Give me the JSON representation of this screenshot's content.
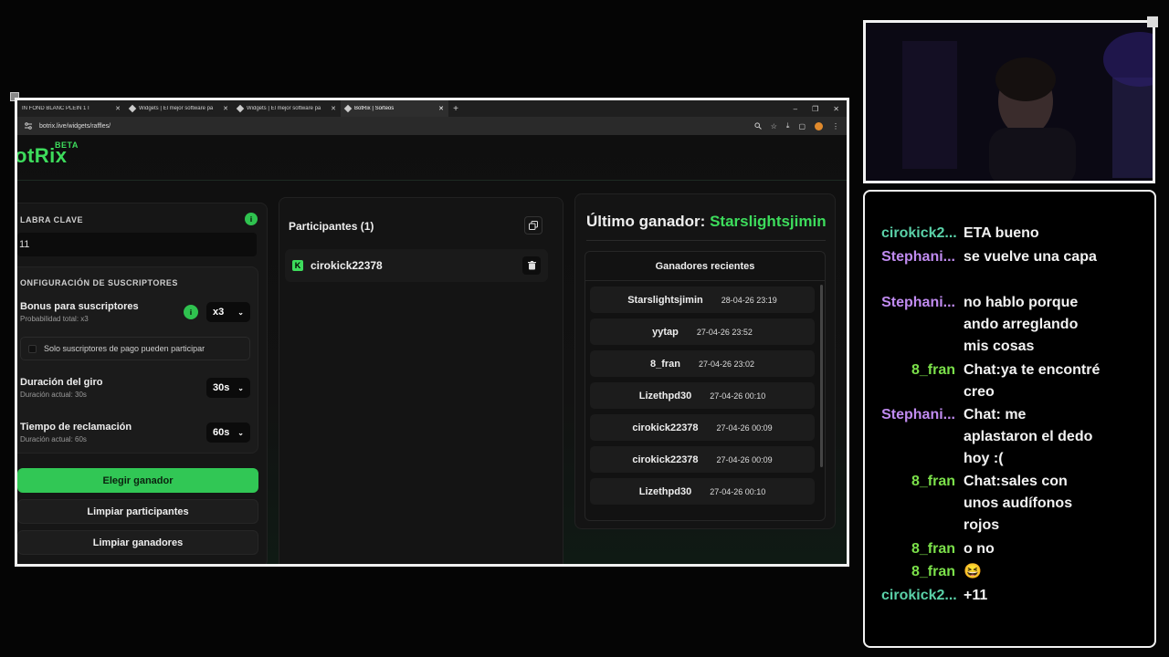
{
  "browser": {
    "tabs": [
      {
        "label": "IN FOND BLANC PLEIN 1 I",
        "active": false
      },
      {
        "label": "Widgets | El mejor software pa",
        "active": false
      },
      {
        "label": "Widgets | El mejor software pa",
        "active": false
      },
      {
        "label": "BotRix | Sorteos",
        "active": true
      }
    ],
    "new_tab": "+",
    "window_controls": [
      "–",
      "❐",
      "✕"
    ],
    "url": "botrix.live/widgets/raffles/",
    "avatar_letter": "A"
  },
  "logo": {
    "text": "otRix",
    "beta": "BETA"
  },
  "keyword": {
    "title": "LABRA CLAVE",
    "value": "11",
    "info": "i"
  },
  "subs": {
    "title": "ONFIGURACIÓN DE SUSCRIPTORES",
    "bonus_label": "Bonus para suscriptores",
    "bonus_sub": "Probabilidad total: x3",
    "bonus_value": "x3",
    "only_paid": "Solo suscriptores de pago pueden participar",
    "spin_label": "Duración del giro",
    "spin_sub": "Duración actual: 30s",
    "spin_value": "30s",
    "claim_label": "Tiempo de reclamación",
    "claim_sub": "Duración actual: 60s",
    "claim_value": "60s"
  },
  "buttons": {
    "pick": "Elegir ganador",
    "clear_participants": "Limpiar participantes",
    "clear_winners": "Limpiar ganadores"
  },
  "participants": {
    "title": "Participantes (1)",
    "items": [
      {
        "name": "cirokick22378"
      }
    ]
  },
  "winner": {
    "prefix": "Último ganador:",
    "name": "Starslightsjimin",
    "recent_title": "Ganadores recientes",
    "recent": [
      {
        "name": "Starslightsjimin",
        "date": "28-04-26 23:19"
      },
      {
        "name": "yytap",
        "date": "27-04-26 23:52"
      },
      {
        "name": "8_fran",
        "date": "27-04-26 23:02"
      },
      {
        "name": "Lizethpd30",
        "date": "27-04-26 00:10"
      },
      {
        "name": "cirokick22378",
        "date": "27-04-26 00:09"
      },
      {
        "name": "cirokick22378",
        "date": "27-04-26 00:09"
      },
      {
        "name": "Lizethpd30",
        "date": "27-04-26 00:10"
      }
    ]
  },
  "chat": {
    "messages": [
      {
        "user": "cirokick2...",
        "text": "ETA bueno",
        "color": "#5ad1a8"
      },
      {
        "user": "Stephani...",
        "text": "se vuelve una capa",
        "color": "#c08bf0"
      },
      {
        "user": "Stephani...",
        "text": "no hablo porque ando arreglando mis cosas",
        "color": "#c08bf0"
      },
      {
        "user": "8_fran",
        "text": "Chat:ya te encontré creo",
        "color": "#7be04a"
      },
      {
        "user": "Stephani...",
        "text": "Chat: me aplastaron el dedo hoy :(",
        "color": "#c08bf0"
      },
      {
        "user": "8_fran",
        "text": "Chat:sales con unos audífonos rojos",
        "color": "#7be04a"
      },
      {
        "user": "8_fran",
        "text": "o no",
        "color": "#7be04a"
      },
      {
        "user": "8_fran",
        "text": "😆",
        "color": "#7be04a"
      },
      {
        "user": "cirokick2...",
        "text": "+11",
        "color": "#5ad1a8"
      }
    ]
  },
  "colors": {
    "accent": "#3ddc5c",
    "button_green": "#31c755"
  }
}
